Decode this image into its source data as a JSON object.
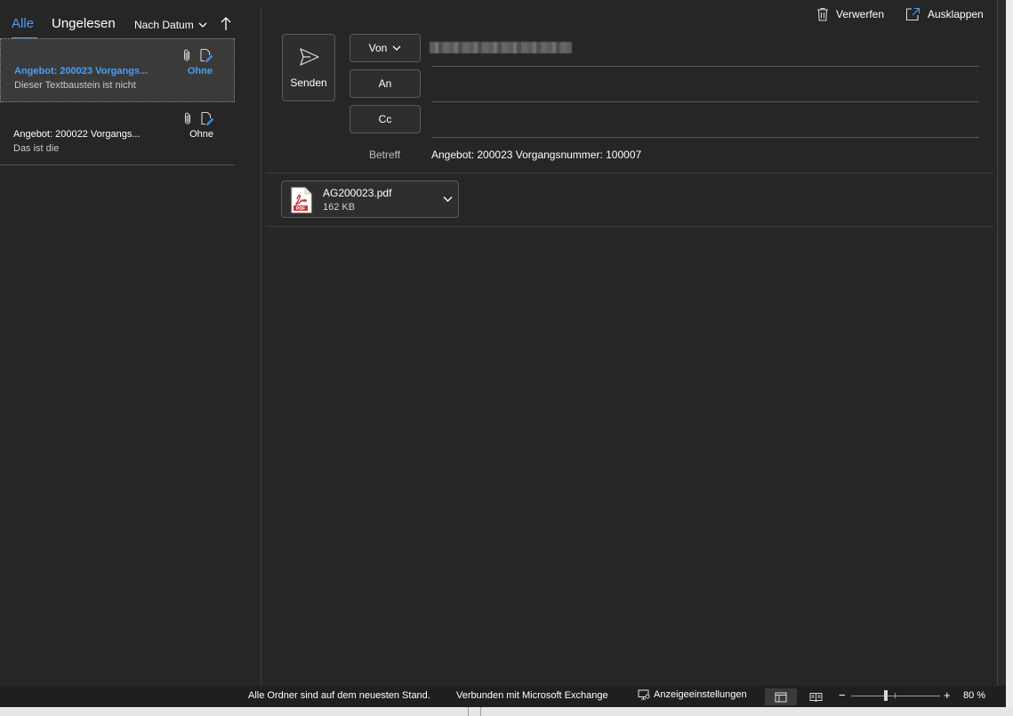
{
  "list": {
    "tabs": [
      {
        "label": "Alle",
        "active": true
      },
      {
        "label": "Ungelesen",
        "active": false
      }
    ],
    "sort_label": "Nach Datum",
    "messages": [
      {
        "subject": "Angebot: 200023 Vorgangs...",
        "category": "Ohne",
        "preview": "Dieser Textbaustein ist nicht",
        "selected": true
      },
      {
        "subject": "Angebot: 200022 Vorgangs...",
        "category": "Ohne",
        "preview": "Das ist die",
        "selected": false
      }
    ]
  },
  "toolbar": {
    "discard_label": "Verwerfen",
    "popout_label": "Ausklappen"
  },
  "compose": {
    "send_label": "Senden",
    "from_label": "Von",
    "to_label": "An",
    "cc_label": "Cc",
    "subject_label": "Betreff",
    "subject_value": "Angebot: 200023 Vorgangsnummer: 100007",
    "attachment": {
      "name": "AG200023.pdf",
      "size": "162 KB"
    }
  },
  "status": {
    "sync_text": "Alle Ordner sind auf dem neuesten Stand.",
    "connection_text": "Verbunden mit Microsoft Exchange",
    "display_settings_label": "Anzeigeeinstellungen",
    "zoom_minus": "−",
    "zoom_plus": "+",
    "zoom_level": "80 %"
  },
  "colors": {
    "accent": "#479ef5",
    "background": "#262626",
    "selected_item": "#3a3a3a",
    "pdf_red": "#d13438"
  }
}
